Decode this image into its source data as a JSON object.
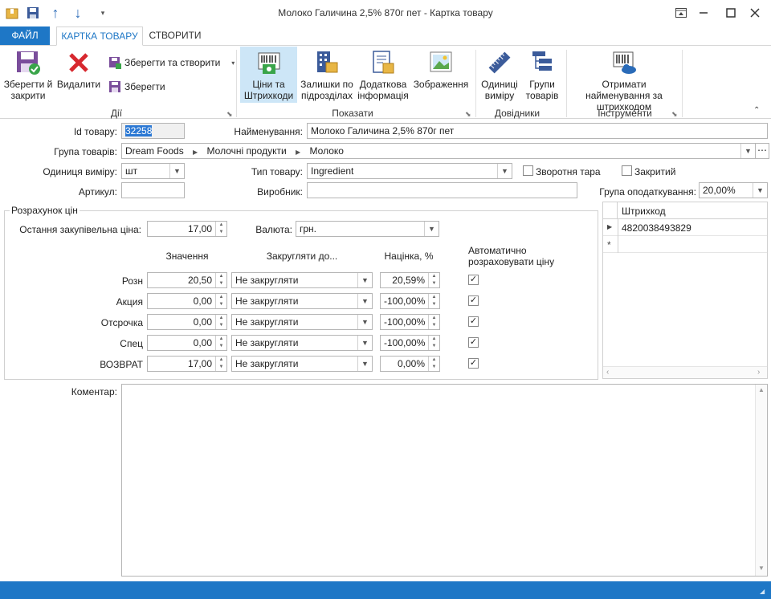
{
  "window": {
    "title": "Молоко Галичина 2,5% 870г пет - Картка товару",
    "qat_icons": [
      "box-icon",
      "save-icon",
      "arrow-up-icon",
      "arrow-down-icon",
      "customize-icon"
    ]
  },
  "tabs": {
    "file": "ФАЙЛ",
    "card": "КАРТКА ТОВАРУ",
    "create": "СТВОРИТИ"
  },
  "ribbon": {
    "save_close": "Зберегти й закрити",
    "delete": "Видалити",
    "save_create": "Зберегти та створити",
    "save": "Зберегти",
    "group_actions": "Дії",
    "prices_barcodes": "Ціни та Штрихкоди",
    "stock_by_units": "Залишки по підрозділах",
    "extra_info": "Додаткова інформація",
    "images": "Зображення",
    "group_show": "Показати",
    "units": "Одиниці виміру",
    "product_groups": "Групи товарів",
    "group_refs": "Довідники",
    "get_names": "Отримати найменування за штрихкодом",
    "group_tools": "Інструменти"
  },
  "form": {
    "id_label": "Id товару:",
    "id_value": "32258",
    "name_label": "Найменування:",
    "name_value": "Молоко Галичина 2,5% 870г пет",
    "group_label": "Група товарів:",
    "group_path": [
      "Dream Foods",
      "Молочні продукти",
      "Молоко"
    ],
    "unit_label": "Одиниця виміру:",
    "unit_value": "шт",
    "type_label": "Тип товару:",
    "type_value": "Ingredient",
    "returnable_label": "Зворотня тара",
    "closed_label": "Закритий",
    "article_label": "Артикул:",
    "article_value": "",
    "maker_label": "Виробник:",
    "maker_value": "",
    "tax_label": "Група оподаткування:",
    "tax_value": "20,00%"
  },
  "pricing": {
    "legend": "Розрахунок цін",
    "last_price_label": "Остання закупівельна ціна:",
    "last_price_value": "17,00",
    "currency_label": "Валюта:",
    "currency_value": "грн.",
    "col_value": "Значення",
    "col_round": "Закругляти до...",
    "col_markup": "Націнка, %",
    "col_auto": "Автоматично розраховувати ціну",
    "rows": [
      {
        "name": "Розн",
        "value": "20,50",
        "round": "Не закругляти",
        "markup": "20,59%",
        "auto": true
      },
      {
        "name": "Акция",
        "value": "0,00",
        "round": "Не закругляти",
        "markup": "-100,00%",
        "auto": true
      },
      {
        "name": "Отсрочка",
        "value": "0,00",
        "round": "Не закругляти",
        "markup": "-100,00%",
        "auto": true
      },
      {
        "name": "Спец",
        "value": "0,00",
        "round": "Не закругляти",
        "markup": "-100,00%",
        "auto": true
      },
      {
        "name": "ВОЗВРАТ",
        "value": "17,00",
        "round": "Не закругляти",
        "markup": "0,00%",
        "auto": true
      }
    ]
  },
  "barcodes": {
    "header": "Штрихкод",
    "rows": [
      "4820038493829"
    ],
    "new_row_marker": "*"
  },
  "comment": {
    "label": "Коментар:",
    "value": ""
  },
  "colors": {
    "accent": "#1e77c6",
    "selected_ribbon": "#cde6f7"
  }
}
